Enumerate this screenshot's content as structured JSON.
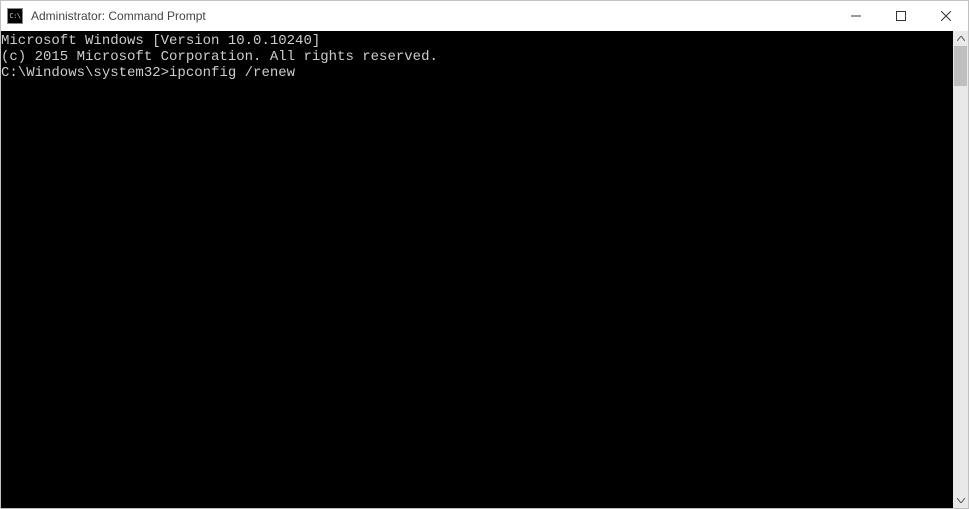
{
  "titlebar": {
    "icon_text": "C:\\",
    "title": "Administrator: Command Prompt"
  },
  "terminal": {
    "line1": "Microsoft Windows [Version 10.0.10240]",
    "line2": "(c) 2015 Microsoft Corporation. All rights reserved.",
    "blank": "",
    "prompt": "C:\\Windows\\system32>",
    "command": "ipconfig /renew"
  }
}
